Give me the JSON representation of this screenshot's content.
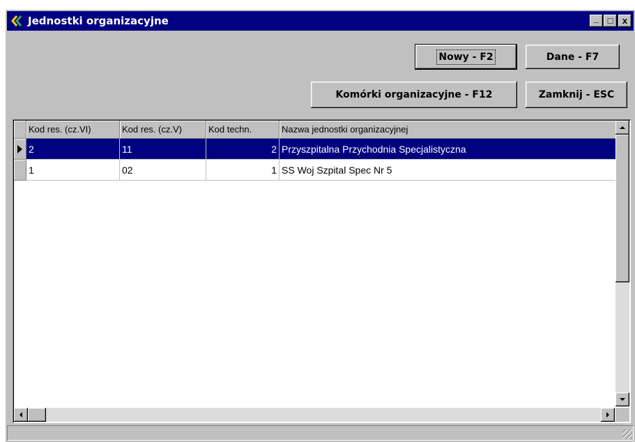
{
  "window": {
    "title": "Jednostki organizacyjne",
    "controls": {
      "minimize": "_",
      "maximize": "□",
      "close": "x"
    }
  },
  "toolbar": {
    "new_label": "Nowy - F2",
    "data_label": "Dane - F7",
    "cells_label": "Komórki organizacyjne - F12",
    "close_label": "Zamknij - ESC"
  },
  "table": {
    "columns": [
      "Kod res. (cz.VI)",
      "Kod res. (cz.V)",
      "Kod techn.",
      "Nazwa jednostki organizacyjnej"
    ],
    "rows": [
      {
        "c1": "2",
        "c2": "11",
        "c3": "2",
        "c4": "Przyszpitalna Przychodnia Specjalistyczna",
        "selected": true
      },
      {
        "c1": "1",
        "c2": "02",
        "c3": "1",
        "c4": "SS Woj Szpital Spec Nr 5",
        "selected": false
      }
    ]
  },
  "icons": {
    "app": "app-logo-icon",
    "record_pointer": "triangle-right-icon",
    "scroll_up": "triangle-up-icon",
    "scroll_down": "triangle-down-icon",
    "scroll_left": "triangle-left-icon",
    "scroll_right": "triangle-right-icon"
  },
  "colors": {
    "titlebar": "#000080",
    "selection": "#000080",
    "face": "#c0c0c0"
  }
}
